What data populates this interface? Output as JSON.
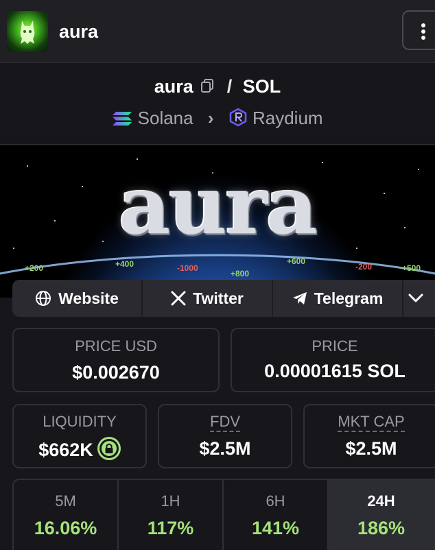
{
  "header": {
    "token_name": "aura",
    "menu_icon": "kebab-menu-icon"
  },
  "pair": {
    "base": "aura",
    "separator": "/",
    "quote": "SOL",
    "chain": "Solana",
    "dex": "Raydium"
  },
  "banner": {
    "title": "aura",
    "numbers": [
      "+200",
      "+400",
      "-1000",
      "+800",
      "+600",
      "-200",
      "+500",
      "+200",
      "-1000"
    ]
  },
  "socials": {
    "website": "Website",
    "twitter": "Twitter",
    "telegram": "Telegram"
  },
  "stats": {
    "price_usd_label": "PRICE USD",
    "price_usd": "$0.002670",
    "price_label": "PRICE",
    "price": "0.00001615 SOL",
    "liquidity_label": "LIQUIDITY",
    "liquidity": "$662K",
    "fdv_label": "FDV",
    "fdv": "$2.5M",
    "mktcap_label": "MKT CAP",
    "mktcap": "$2.5M"
  },
  "timeframes": [
    {
      "label": "5M",
      "value": "16.06%"
    },
    {
      "label": "1H",
      "value": "117%"
    },
    {
      "label": "6H",
      "value": "141%"
    },
    {
      "label": "24H",
      "value": "186%"
    }
  ],
  "colors": {
    "background": "#17171b",
    "positive": "#a6e27a",
    "label": "#9a9aa2"
  }
}
